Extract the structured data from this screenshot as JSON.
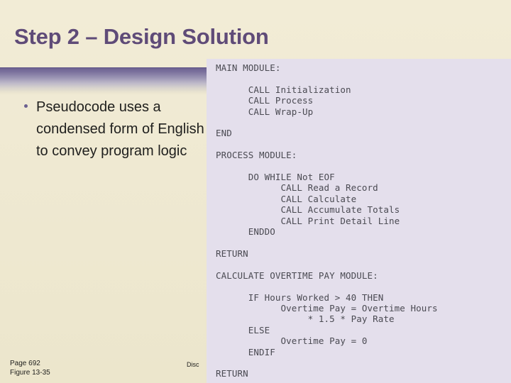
{
  "slide": {
    "title": "Step 2 – Design Solution",
    "accent_color": "#5f4b78",
    "band_color": "#6b6090",
    "background_color": "#efe9d2"
  },
  "body": {
    "bullets": [
      "Pseudocode uses a condensed form of English to convey program logic"
    ]
  },
  "figure": {
    "panel_color": "#e4dfec",
    "text_color": "#4a4a52",
    "pseudocode": "MAIN MODULE:\n\n      CALL Initialization\n      CALL Process\n      CALL Wrap-Up\n\nEND\n\nPROCESS MODULE:\n\n      DO WHILE Not EOF\n            CALL Read a Record\n            CALL Calculate\n            CALL Accumulate Totals\n            CALL Print Detail Line\n      ENDDO\n\nRETURN\n\nCALCULATE OVERTIME PAY MODULE:\n\n      IF Hours Worked > 40 THEN\n            Overtime Pay = Overtime Hours\n                 * 1.5 * Pay Rate\n      ELSE\n            Overtime Pay = 0\n      ENDIF\n\nRETURN"
  },
  "footer": {
    "page": "Page 692",
    "figure_number": "Figure 13-35",
    "center_note": "Disc"
  }
}
